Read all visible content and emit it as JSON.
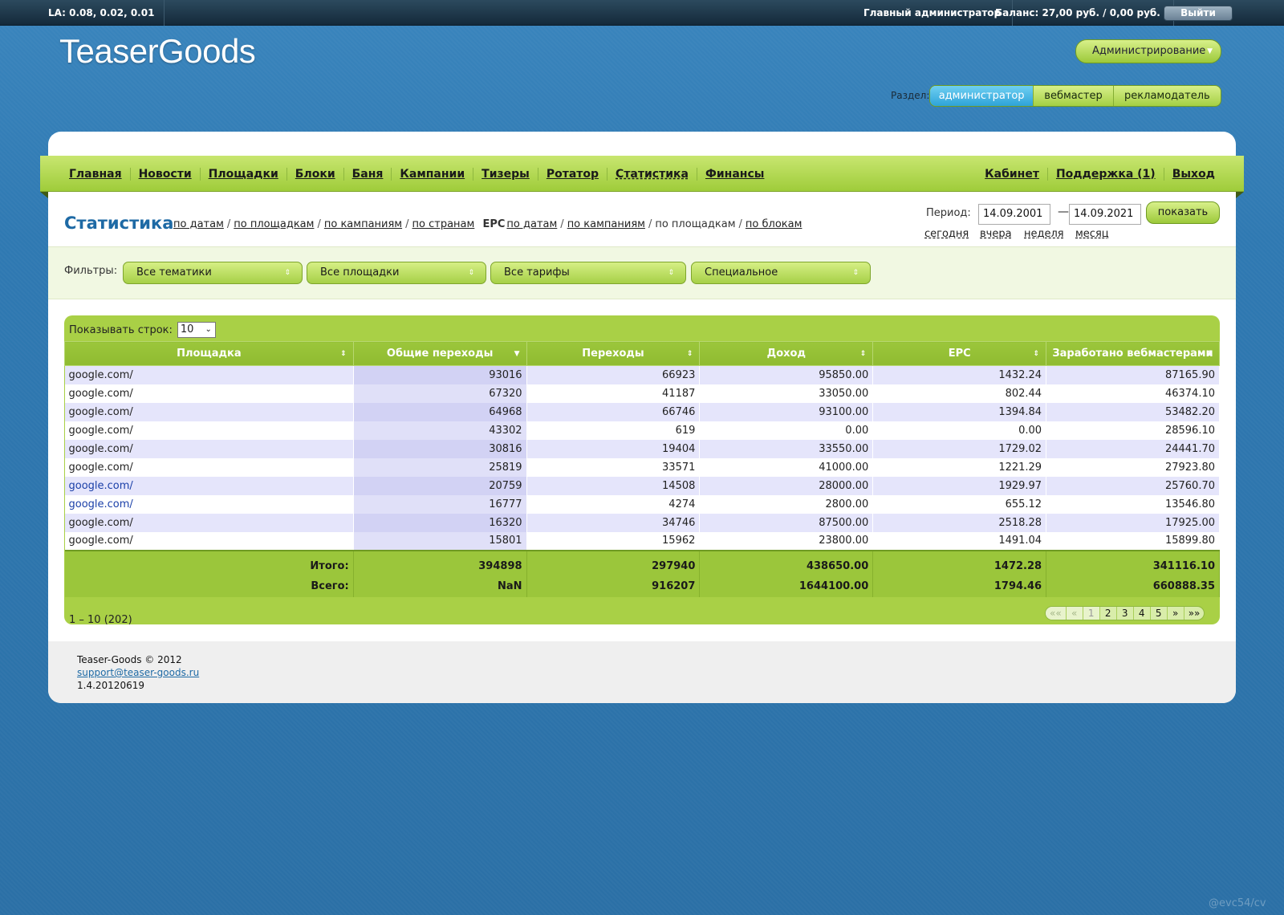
{
  "topbar": {
    "la": "LA: 0.08, 0.02, 0.01",
    "user": "Главный администратор",
    "balance": "Баланс: 27,00 руб. / 0,00 руб.",
    "logout": "Выйти"
  },
  "header": {
    "logo": "TeaserGoods",
    "admin_menu": "Администрирование",
    "section_label": "Раздел:",
    "sections": [
      "администратор",
      "вебмастер",
      "рекламодатель"
    ],
    "active_section": "администратор"
  },
  "nav": {
    "left": [
      "Главная",
      "Новости",
      "Площадки",
      "Блоки",
      "Баня",
      "Кампании",
      "Тизеры",
      "Ротатор",
      "Статистика",
      "Финансы"
    ],
    "right": [
      "Кабинет",
      "Поддержка (1)",
      "Выход"
    ]
  },
  "page": {
    "title": "Статистика",
    "links": {
      "by_dates": "по датам",
      "by_sites": "по площадкам",
      "by_campaigns": "по кампаниям",
      "by_countries": "по странам",
      "epc_label": "EPC",
      "epc_by_dates": "по датам",
      "epc_by_campaigns": "по кампаниям",
      "epc_by_sites": "по площадкам",
      "epc_by_blocks": "по блокам"
    }
  },
  "period": {
    "label": "Период:",
    "from": "14.09.2001",
    "to": "14.09.2021",
    "dash": "—",
    "show": "показать",
    "quick": [
      "сегодня",
      "вчера",
      "неделя",
      "месяц"
    ]
  },
  "filters": {
    "label": "Фильтры:",
    "selects": [
      "Все тематики",
      "Все площадки",
      "Все тарифы",
      "Специальное"
    ]
  },
  "table": {
    "rows_label": "Показывать строк:",
    "rows_value": "10",
    "columns": [
      "Площадка",
      "Общие переходы",
      "Переходы",
      "Доход",
      "EPC",
      "Заработано вебмастерами"
    ],
    "rows": [
      [
        "google.com/",
        "93016",
        "66923",
        "95850.00",
        "1432.24",
        "87165.90"
      ],
      [
        "google.com/",
        "67320",
        "41187",
        "33050.00",
        "802.44",
        "46374.10"
      ],
      [
        "google.com/",
        "64968",
        "66746",
        "93100.00",
        "1394.84",
        "53482.20"
      ],
      [
        "google.com/",
        "43302",
        "619",
        "0.00",
        "0.00",
        "28596.10"
      ],
      [
        "google.com/",
        "30816",
        "19404",
        "33550.00",
        "1729.02",
        "24441.70"
      ],
      [
        "google.com/",
        "25819",
        "33571",
        "41000.00",
        "1221.29",
        "27923.80"
      ],
      [
        "google.com/",
        "20759",
        "14508",
        "28000.00",
        "1929.97",
        "25760.70"
      ],
      [
        "google.com/",
        "16777",
        "4274",
        "2800.00",
        "655.12",
        "13546.80"
      ],
      [
        "google.com/",
        "16320",
        "34746",
        "87500.00",
        "2518.28",
        "17925.00"
      ],
      [
        "google.com/",
        "15801",
        "15962",
        "23800.00",
        "1491.04",
        "15899.80"
      ]
    ],
    "totals": [
      [
        "Итого:",
        "394898",
        "297940",
        "438650.00",
        "1472.28",
        "341116.10"
      ],
      [
        "Всего:",
        "NaN",
        "916207",
        "1644100.00",
        "1794.46",
        "660888.35"
      ]
    ],
    "range": "1 – 10 (202)",
    "pager": [
      "««",
      "«",
      "1",
      "2",
      "3",
      "4",
      "5",
      "»",
      "»»"
    ]
  },
  "footer": {
    "copyright": "Teaser-Goods © 2012",
    "email": "support@teaser-goods.ru",
    "version": "1.4.20120619"
  },
  "watermark": "@evc54/cv"
}
